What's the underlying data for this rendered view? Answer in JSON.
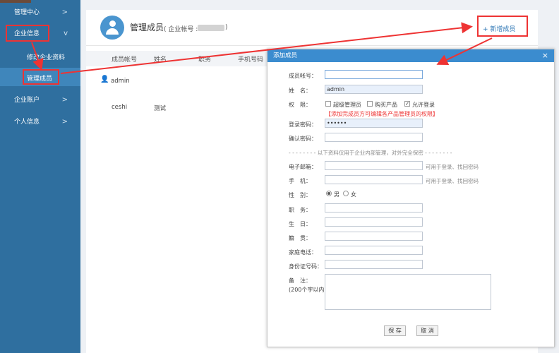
{
  "sidebar": {
    "items": [
      {
        "label": "管理中心",
        "chevron": ">"
      },
      {
        "label": "企业信息",
        "chevron": "v"
      },
      {
        "label": "企业账户",
        "chevron": ">"
      },
      {
        "label": "个人信息",
        "chevron": ">"
      }
    ],
    "sub_items": [
      "修改企业资料",
      "管理成员"
    ]
  },
  "header": {
    "title": "管理成员",
    "account_label": "( 企业帐号 :",
    "account_close": ")",
    "add_button": "+ 新增成员"
  },
  "table": {
    "columns": [
      "成员帐号",
      "姓名",
      "职务",
      "手机号码"
    ],
    "rows": [
      {
        "account": "admin",
        "name": ""
      },
      {
        "account": "ceshi",
        "name": "测试"
      }
    ]
  },
  "dialog": {
    "title": "添加成员",
    "close": "×",
    "fields": {
      "account_label": "成员帐号：",
      "account_value": "",
      "name_label": "姓　名：",
      "name_value": "admin",
      "perm_label": "权　限：",
      "perm_options": [
        "超级管理员",
        "购买产品",
        "允许登录"
      ],
      "perm_warning": "【添加完成员方可编辑各产品管理员的权限】",
      "password_label": "登录密码：",
      "password_value": "••••••",
      "confirm_label": "确认密码：",
      "divider": "- - - - - - - -  以下资料仅用于企业内部管理，对外完全保密  - - - - - - - -",
      "email_label": "电子邮箱：",
      "email_hint": "可用于登录、找回密码",
      "mobile_label": "手　机：",
      "mobile_hint": "可用于登录、找回密码",
      "gender_label": "性　别：",
      "gender_male": "男",
      "gender_female": "女",
      "job_label": "职　务：",
      "birthday_label": "生　日：",
      "origin_label": "籍　贯：",
      "phone_label": "家庭电话：",
      "idcard_label": "身份证号码：",
      "remark_label": "备　注：",
      "remark_hint": "(200个字以内)"
    },
    "save_button": "保 存",
    "cancel_button": "取 消"
  },
  "colors": {
    "sidebar": "#2f6f9f",
    "dialog_title": "#3b8ccf",
    "annotation": "#ee3333",
    "link": "#2f77b5"
  }
}
